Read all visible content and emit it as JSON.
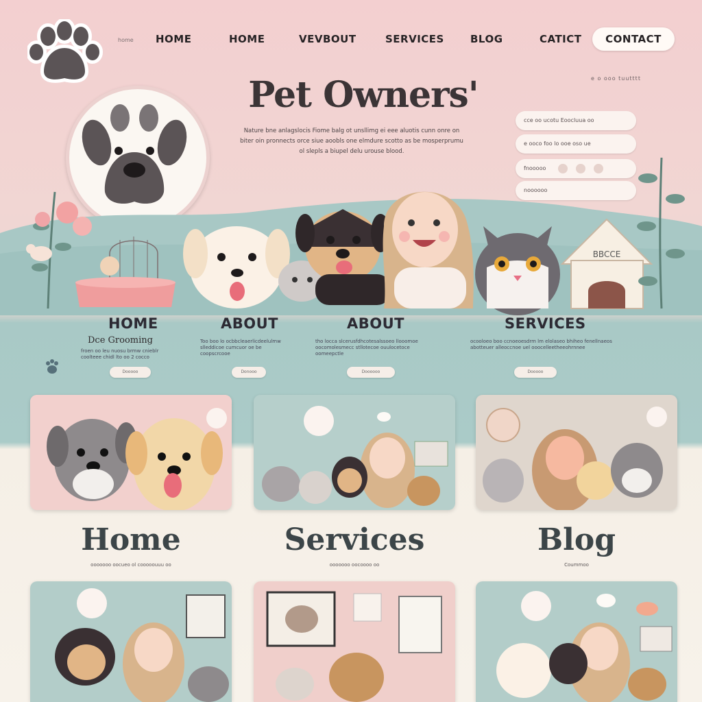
{
  "nav": {
    "tiny_label": "home",
    "items": [
      "HOME",
      "HOME",
      "VEVBOUT",
      "SERVICES",
      "BLOG",
      "CATICT"
    ],
    "contact": "CONTACT"
  },
  "hero": {
    "title": "Pet Owners'",
    "subtitle": "Nature bne anlagslocis Fiome balg ot unsllimg ei eee aluotis cunn onre on biter oin pronnects orce siue aoobls one elmdure scotto as be mosperprumu ol slepls a biupel delu urouse blood.",
    "corner_note": "e  o  ooo  tuutttt",
    "pills": [
      "cce oo ucotu Eoocluua oo",
      "e ooco  foo  lo ooe oso ue",
      "fnooooo",
      "noooooo"
    ]
  },
  "scene": {
    "house_sign": "BBCCE"
  },
  "sections": [
    {
      "title": "HOME",
      "sub": "Dce Grooming",
      "text": "froen oo leu nuosu brmw cnieblr coolteee chidl lto oo 2 cocco",
      "button": "Dooooo"
    },
    {
      "title": "ABOUT",
      "sub": "",
      "text": "Too boo lo ocbbcleaerlicdeelulmw slleddicoe cumcuor oe be coopscrcooe",
      "button": "Donooo"
    },
    {
      "title": "ABOUT",
      "sub": "",
      "text": "tho locca slcerusfdhcotesalssoeo llooomoe oocomolesmecc stllotecoe ouulocetoce oomeepctle",
      "button": "Doooooo"
    },
    {
      "title": "SERVICES",
      "sub": "",
      "text": "ocooloeo boo ccnoeoesdrm lm elolaseo bhiheo fenellnaeos abotteuer alleoccnoe uel ooocelleetheeohrnnee",
      "button": "Dooooo"
    }
  ],
  "columns": [
    {
      "title": "Home",
      "sub": "ooooooo oocueo ol cooooouuu oo"
    },
    {
      "title": "Services",
      "sub": "ooooooo oocoooo oo"
    },
    {
      "title": "Blog",
      "sub": "Coummoo"
    }
  ],
  "colors": {
    "pink": "#f3cfd0",
    "teal": "#a9c9c6",
    "cream": "#f7f2ea",
    "paw": "#5b5456"
  },
  "icons": [
    "paw-logo-icon",
    "paw-icon",
    "bird-icon",
    "house-icon",
    "flower-icon"
  ]
}
